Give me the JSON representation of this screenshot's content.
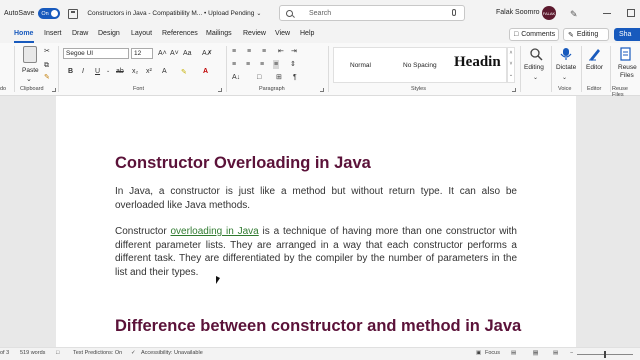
{
  "titlebar": {
    "autosave_label": "AutoSave",
    "autosave_state": "On",
    "document_title": "Constructors in Java  -  Compatibility M...  •  Upload Pending",
    "search_placeholder": "Search",
    "user_name": "Falak Soomro",
    "avatar_initials": "FALAK"
  },
  "menu": {
    "tabs": [
      "Home",
      "Insert",
      "Draw",
      "Design",
      "Layout",
      "References",
      "Mailings",
      "Review",
      "View",
      "Help"
    ],
    "active": "Home",
    "comments_label": "Comments",
    "editing_label": "Editing",
    "share_label": "Sha"
  },
  "ribbon": {
    "paste_label": "Paste",
    "font_name": "Segoe UI",
    "font_size": "12",
    "groups": {
      "undo": "do",
      "clipboard": "Clipboard",
      "font": "Font",
      "paragraph": "Paragraph",
      "styles": "Styles",
      "voice": "Voice",
      "editor": "Editor",
      "reuse_files": "Reuse Files"
    },
    "styles": {
      "normal": "Normal",
      "no_spacing": "No Spacing",
      "heading": "Headin"
    },
    "editing_label": "Editing",
    "dictate_label": "Dictate",
    "editor_label": "Editor",
    "reuse_label_1": "Reuse",
    "reuse_label_2": "Files",
    "accent_color": "#185abd"
  },
  "document": {
    "heading_1": "Constructor Overloading in Java",
    "para_1": "In Java, a constructor is just like a method but without return type. It can also be overloaded like Java methods.",
    "para_2_prefix": "Constructor ",
    "para_2_link": "overloading in Java",
    "para_2_rest": " is a technique of having more than one constructor with different parameter lists. They are arranged in a way that each constructor performs a different task. They are differentiated by the compiler by the number of parameters in the list and their types.",
    "heading_2": "Difference between constructor and method in Java",
    "heading_color": "#5b1239",
    "link_color": "#2f7a2f"
  },
  "status": {
    "page": "of 3",
    "words": "519 words",
    "text_predictions": "Text Predictions: On",
    "accessibility": "Accessibility: Unavailable",
    "focus": "Focus"
  }
}
